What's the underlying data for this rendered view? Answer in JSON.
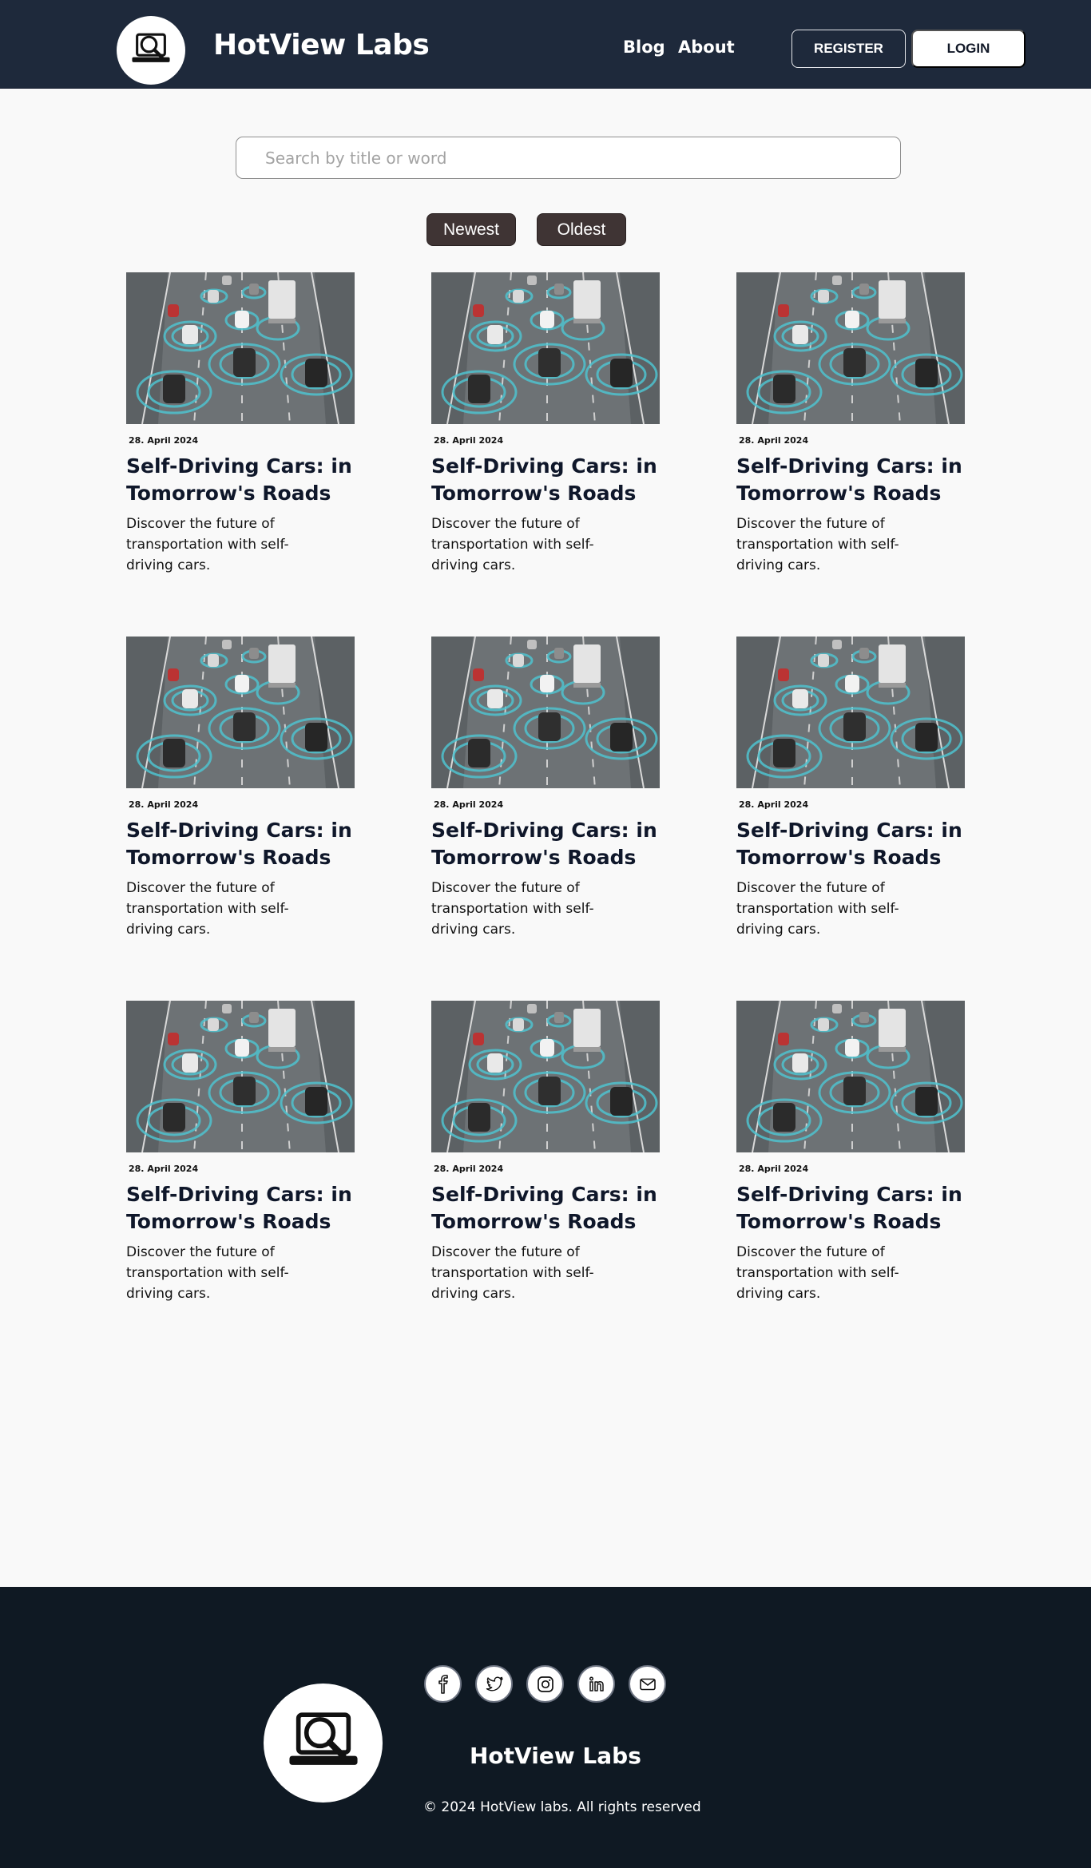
{
  "header": {
    "brand": "HotView Labs",
    "nav": [
      {
        "label": "Blog"
      },
      {
        "label": "About"
      }
    ],
    "register_label": "REGISTER",
    "login_label": "LOGIN",
    "logo_icon": "magnifier-laptop-logo-icon"
  },
  "search": {
    "placeholder": "Search by title or word",
    "value": ""
  },
  "sort": {
    "newest_label": "Newest",
    "oldest_label": "Oldest"
  },
  "posts": [
    {
      "date": "28. April 2024",
      "title": "Self-Driving Cars:  in Tomorrow's Roads",
      "description": "Discover the future of transportation with self-driving cars."
    },
    {
      "date": "28. April 2024",
      "title": "Self-Driving Cars:  in Tomorrow's Roads",
      "description": "Discover the future of transportation with self-driving cars."
    },
    {
      "date": "28. April 2024",
      "title": "Self-Driving Cars:  in Tomorrow's Roads",
      "description": "Discover the future of transportation with self-driving cars."
    },
    {
      "date": "28. April 2024",
      "title": "Self-Driving Cars:  in Tomorrow's Roads",
      "description": "Discover the future of transportation with self-driving cars."
    },
    {
      "date": "28. April 2024",
      "title": "Self-Driving Cars:  in Tomorrow's Roads",
      "description": "Discover the future of transportation with self-driving cars."
    },
    {
      "date": "28. April 2024",
      "title": "Self-Driving Cars:  in Tomorrow's Roads",
      "description": "Discover the future of transportation with self-driving cars."
    },
    {
      "date": "28. April 2024",
      "title": "Self-Driving Cars:  in Tomorrow's Roads",
      "description": "Discover the future of transportation with self-driving cars."
    },
    {
      "date": "28. April 2024",
      "title": "Self-Driving Cars:  in Tomorrow's Roads",
      "description": "Discover the future of transportation with self-driving cars."
    },
    {
      "date": "28. April 2024",
      "title": "Self-Driving Cars:  in Tomorrow's Roads",
      "description": "Discover the future of transportation with self-driving cars."
    }
  ],
  "footer": {
    "brand": "HotView Labs",
    "copyright": "© 2024 HotView labs. All rights reserved",
    "social": [
      "facebook-icon",
      "twitter-icon",
      "instagram-icon",
      "linkedin-icon",
      "mail-icon"
    ]
  },
  "colors": {
    "header_bg": "#1e293b",
    "footer_bg": "#0f1923",
    "sort_button_bg": "#3f3434",
    "page_bg": "#f9f9f9",
    "sensor_ring": "#4fc3cf"
  }
}
